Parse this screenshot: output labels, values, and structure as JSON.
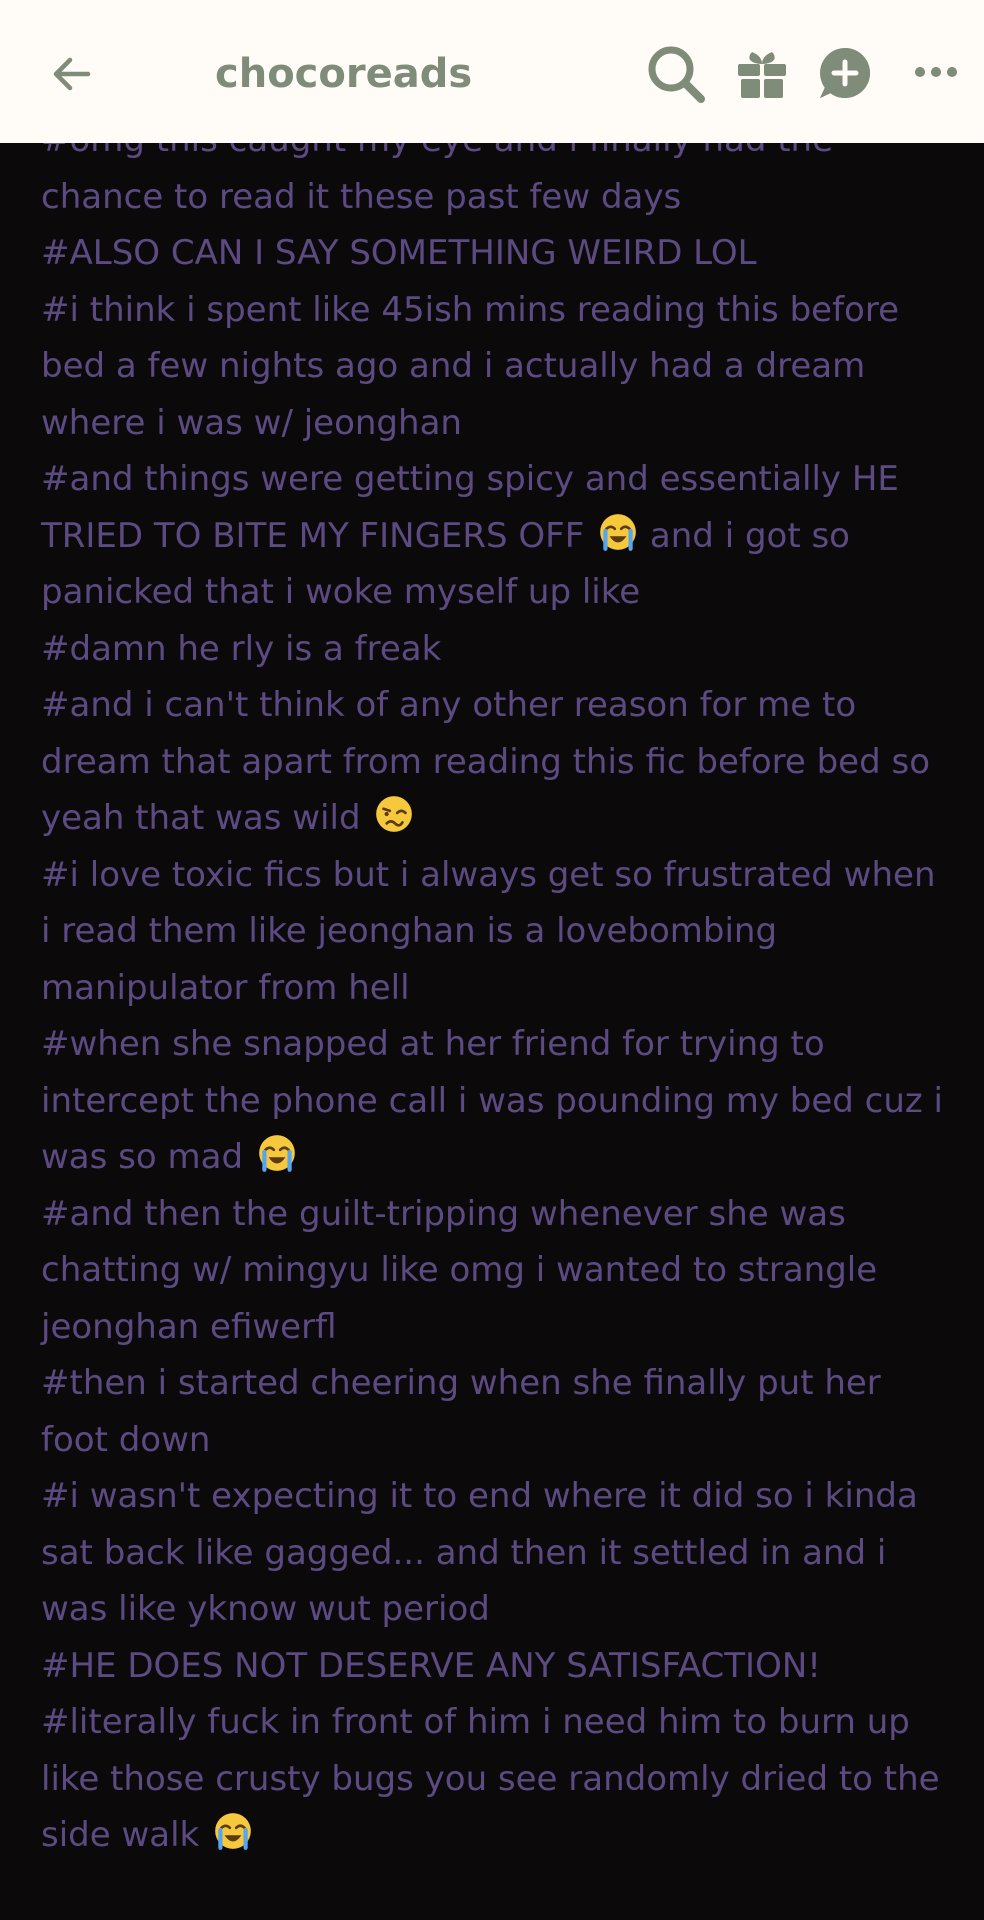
{
  "header": {
    "blog_name": "chocoreads",
    "colors": {
      "background": "#fffcf8",
      "icon": "#7e8c79"
    },
    "icons": [
      "back-arrow-icon",
      "search-icon",
      "gift-icon",
      "new-post-icon",
      "more-options-icon"
    ]
  },
  "post": {
    "colors": {
      "background": "#0b090a",
      "tag_text": "#5c4a82"
    },
    "tags": [
      "#omg this caught my eye and i finally had the chance to read it these past few days",
      "#ALSO CAN I SAY SOMETHING WEIRD LOL",
      "#i think i spent like 45ish mins reading this before bed a few nights ago and i actually had a dream where i was w/ jeonghan",
      "#and things were getting spicy and essentially HE TRIED TO BITE MY FINGERS OFF",
      "and i got so panicked that i woke myself up like",
      "#damn he rly is a freak",
      "#and i can't think of any other reason for me to dream that apart from reading this fic before bed so yeah that was wild",
      "#i love toxic fics but i always get so frustrated when i read them like jeonghan is a lovebombing manipulator from hell",
      "#when she snapped at her friend for trying to intercept the phone call i was pounding my bed cuz i was so mad",
      "#and then the guilt-tripping whenever she was chatting w/ mingyu like omg i wanted to strangle jeonghan efiwerfl",
      "#then i started cheering when she finally put her foot down",
      "#i wasn't expecting it to end where it did so i kinda sat back like gagged... and then it settled in and i was like yknow wut period",
      "#HE DOES NOT DESERVE ANY SATISFACTION!",
      "#literally fuck in front of him i need him to burn up like those crusty bugs you see randomly dried to the side walk"
    ]
  }
}
